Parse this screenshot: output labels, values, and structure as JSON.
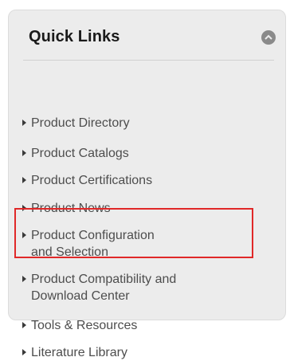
{
  "panel": {
    "title": "Quick Links",
    "toggle_icon": "collapse-chevron-icon"
  },
  "links": [
    {
      "label": "Product Directory"
    },
    {
      "label": "Product Catalogs"
    },
    {
      "label": "Product Certifications"
    },
    {
      "label": "Product News"
    },
    {
      "label": "Product Configuration\nand Selection"
    },
    {
      "label": "Product Compatibility and\nDownload Center",
      "highlighted": true
    },
    {
      "label": "Tools & Resources"
    },
    {
      "label": "Literature Library"
    }
  ],
  "colors": {
    "panel_bg": "#ececec",
    "link_text": "#4d4d4d",
    "highlight": "#e02828"
  }
}
